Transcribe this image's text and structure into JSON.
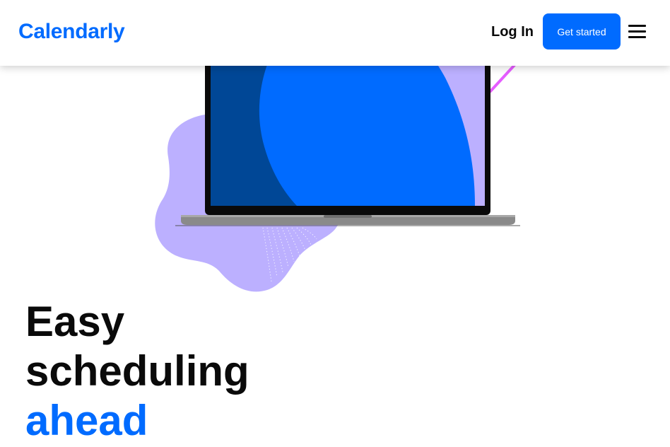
{
  "header": {
    "logo_text": "Calendarly",
    "login_label": "Log In",
    "cta_label": "Get started",
    "menu_icon": "hamburger-menu-icon"
  },
  "hero": {
    "headline_line1": "Easy",
    "headline_line2": "scheduling",
    "headline_line3": "ahead",
    "illustration": "laptop-illustration"
  },
  "colors": {
    "brand_blue": "#006bff",
    "dark_blue": "#004796",
    "lavender": "#bcb0ff",
    "magenta": "#e55cff",
    "text_dark": "#0a0a0a"
  }
}
